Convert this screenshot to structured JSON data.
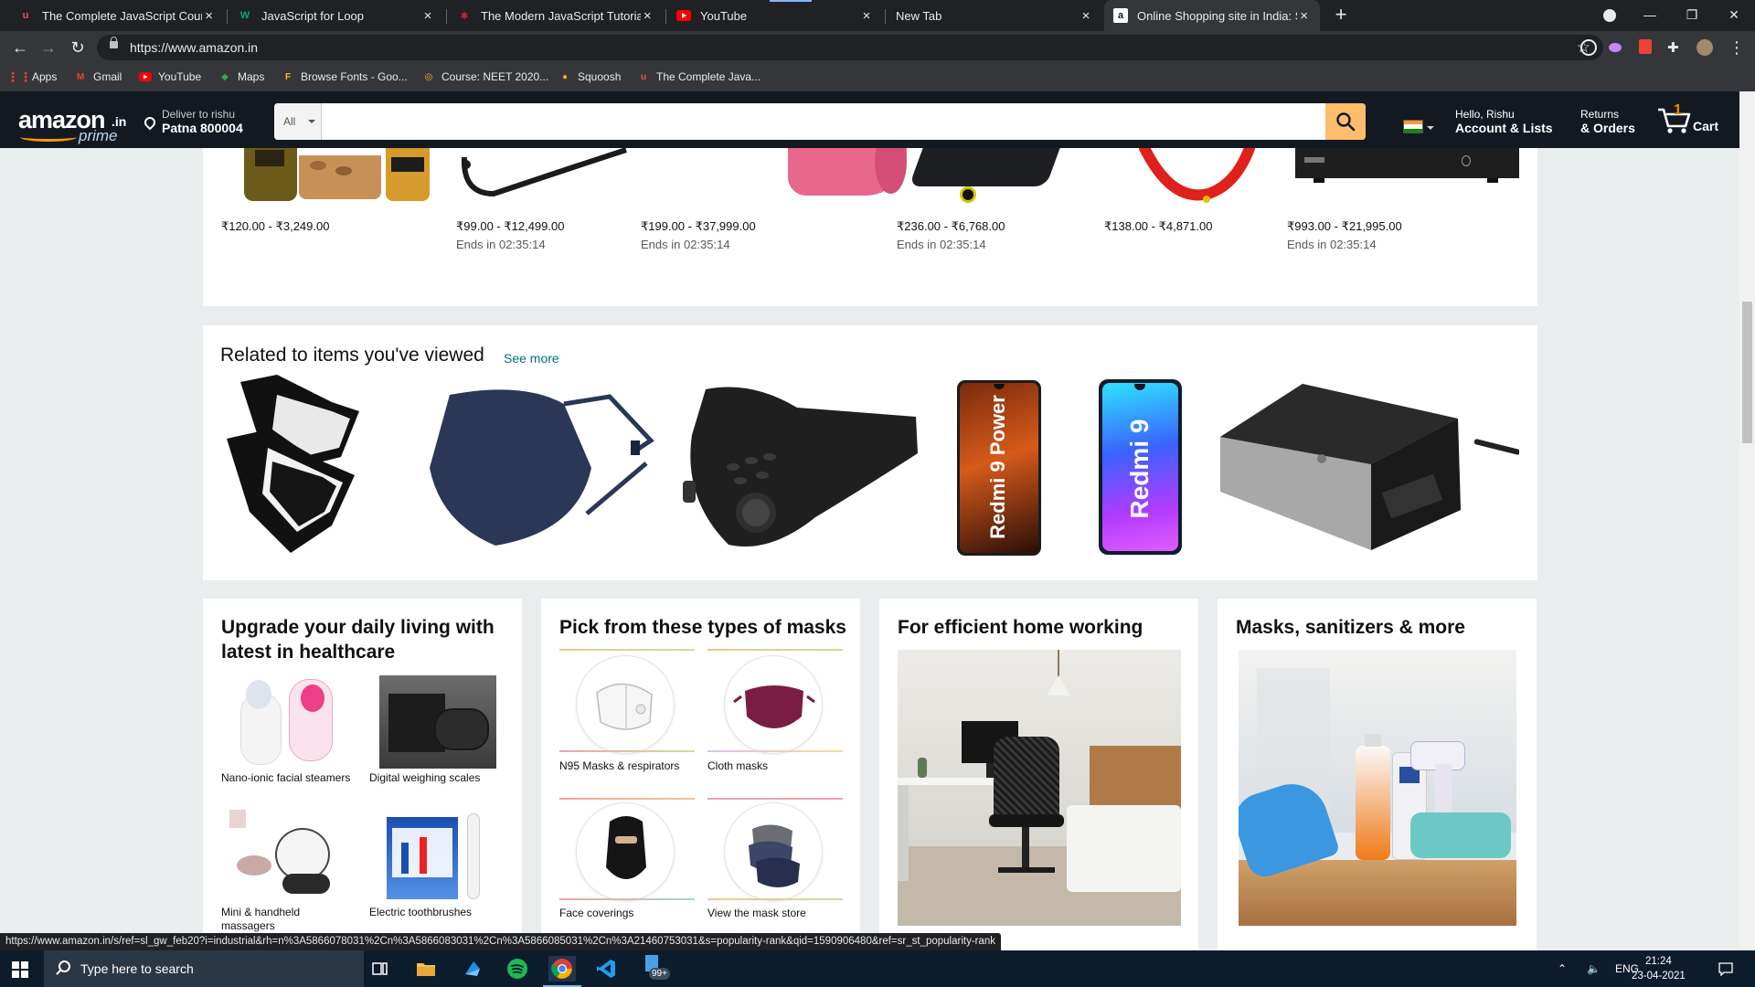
{
  "browser": {
    "tabs": [
      {
        "title": "The Complete JavaScript Course",
        "favicon": "udemy-icon",
        "color": "#ec5252"
      },
      {
        "title": "JavaScript for Loop",
        "favicon": "w-icon",
        "color": "#04aa6d"
      },
      {
        "title": "The Modern JavaScript Tutorial",
        "favicon": "javascript-info-icon",
        "color": "#c23"
      },
      {
        "title": "YouTube",
        "favicon": "youtube-icon",
        "color": "#ff0000"
      },
      {
        "title": "New Tab",
        "favicon": "",
        "color": ""
      },
      {
        "title": "Online Shopping site in India: Sh",
        "favicon": "amazon-icon",
        "color": "#ffffff"
      }
    ],
    "url": "https://www.amazon.in",
    "bookmarks": [
      {
        "label": "Apps",
        "icon": "apps-grid-icon"
      },
      {
        "label": "Gmail",
        "icon": "gmail-icon"
      },
      {
        "label": "YouTube",
        "icon": "youtube-icon"
      },
      {
        "label": "Maps",
        "icon": "maps-icon"
      },
      {
        "label": "Browse Fonts - Goo...",
        "icon": "google-fonts-icon"
      },
      {
        "label": "Course: NEET 2020...",
        "icon": "course-icon"
      },
      {
        "label": "Squoosh",
        "icon": "squoosh-icon"
      },
      {
        "label": "The Complete Java...",
        "icon": "udemy-icon"
      }
    ],
    "status_url": "https://www.amazon.in/s/ref=sl_gw_feb20?i=industrial&rh=n%3A5866078031%2Cn%3A5866083031%2Cn%3A5866085031%2Cn%3A21460753031&s=popularity-rank&qid=1590906480&ref=sr_st_popularity-rank"
  },
  "amazon": {
    "logo_word": "amazon",
    "logo_tld": ".in",
    "logo_prime": "prime",
    "deliver_line1": "Deliver to rishu",
    "deliver_line2": "Patna 800004",
    "search_category": "All",
    "search_value": "",
    "account_line1": "Hello, Rishu",
    "account_line2": "Account & Lists",
    "returns_line1": "Returns",
    "returns_line2": "& Orders",
    "cart_count": "1",
    "cart_label": "Cart",
    "accent_color": "#febd69"
  },
  "deals": [
    {
      "price": "₹120.00 - ₹3,249.00",
      "ends": ""
    },
    {
      "price": "₹99.00 - ₹12,499.00",
      "ends": "Ends in 02:35:14"
    },
    {
      "price": "₹199.00 - ₹37,999.00",
      "ends": "Ends in 02:35:14"
    },
    {
      "price": "₹236.00 - ₹6,768.00",
      "ends": "Ends in 02:35:14"
    },
    {
      "price": "₹138.00 - ₹4,871.00",
      "ends": ""
    },
    {
      "price": "₹993.00 - ₹21,995.00",
      "ends": "Ends in 02:35:14"
    }
  ],
  "related": {
    "title": "Related to items you've viewed",
    "see_more": "See more",
    "phone1_text": "Redmi 9 Power",
    "phone2_text": "Redmi 9"
  },
  "cards": {
    "healthcare": {
      "title": "Upgrade your daily living with latest in healthcare",
      "items": [
        "Nano-ionic facial steamers",
        "Digital weighing scales",
        "Mini & handheld massagers",
        "Electric toothbrushes"
      ]
    },
    "masks": {
      "title": "Pick from these types of masks",
      "items": [
        "N95 Masks & respirators",
        "Cloth masks",
        "Face coverings",
        "View the mask store"
      ]
    },
    "home_working": {
      "title": "For efficient home working"
    },
    "sanitizers": {
      "title": "Masks, sanitizers & more"
    }
  },
  "taskbar": {
    "search_placeholder": "Type here to search",
    "badge": "99+",
    "language": "ENG",
    "time": "21:24",
    "date": "23-04-2021"
  }
}
